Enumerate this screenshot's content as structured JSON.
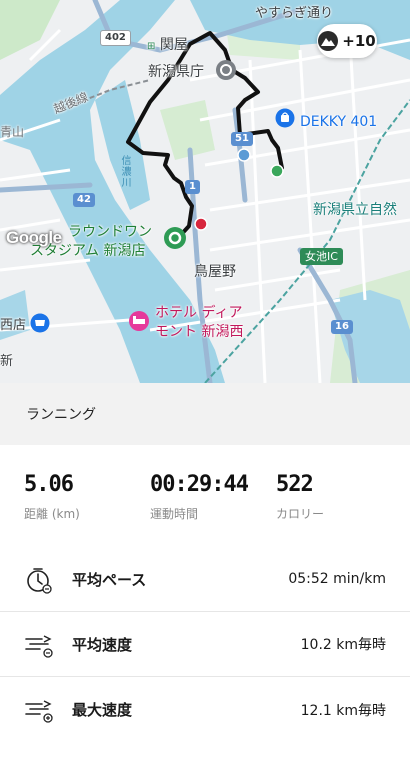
{
  "map": {
    "elevation_badge": "+10",
    "labels": {
      "yasuragi": "やすらぎ通り",
      "sekiya": "関屋",
      "prefectural_office": "新潟県庁",
      "etsugo_line": "越後線",
      "aoyama": "青山",
      "shinano_river": "信濃川",
      "dekky": "DEKKY 401",
      "prefectural_museum": "新潟県立自然",
      "round1_line1": "ラウンドワン",
      "round1_line2": "スタジアム 新潟店",
      "toriyano": "鳥屋野",
      "meikenishi": "西店",
      "hotel_line1": "ホテル ディア",
      "hotel_line2": "モント 新潟西",
      "shin": "新",
      "onnaike_ic": "女池IC",
      "google": "Google"
    },
    "road_numbers": {
      "r402": "402",
      "r42": "42",
      "r51": "51",
      "r1": "1",
      "r16": "16"
    }
  },
  "activity": {
    "type_label": "ランニング"
  },
  "stats": {
    "distance": {
      "value": "5.06",
      "caption": "距離 (km)"
    },
    "duration": {
      "value": "00:29:44",
      "caption": "運動時間"
    },
    "calories": {
      "value": "522",
      "caption": "カロリー"
    }
  },
  "metrics": [
    {
      "label": "平均ペース",
      "value": "05:52 min/km",
      "icon": "stopwatch-icon"
    },
    {
      "label": "平均速度",
      "value": "10.2 km毎時",
      "icon": "speed-average-icon"
    },
    {
      "label": "最大速度",
      "value": "12.1 km毎時",
      "icon": "speed-max-icon"
    }
  ],
  "colors": {
    "route": "#111111",
    "start_marker": "#2e9b55",
    "end_marker": "#d7263d",
    "water": "#9fd3e6",
    "park": "#cde9c9",
    "header_bg": "#f2f2f2"
  }
}
